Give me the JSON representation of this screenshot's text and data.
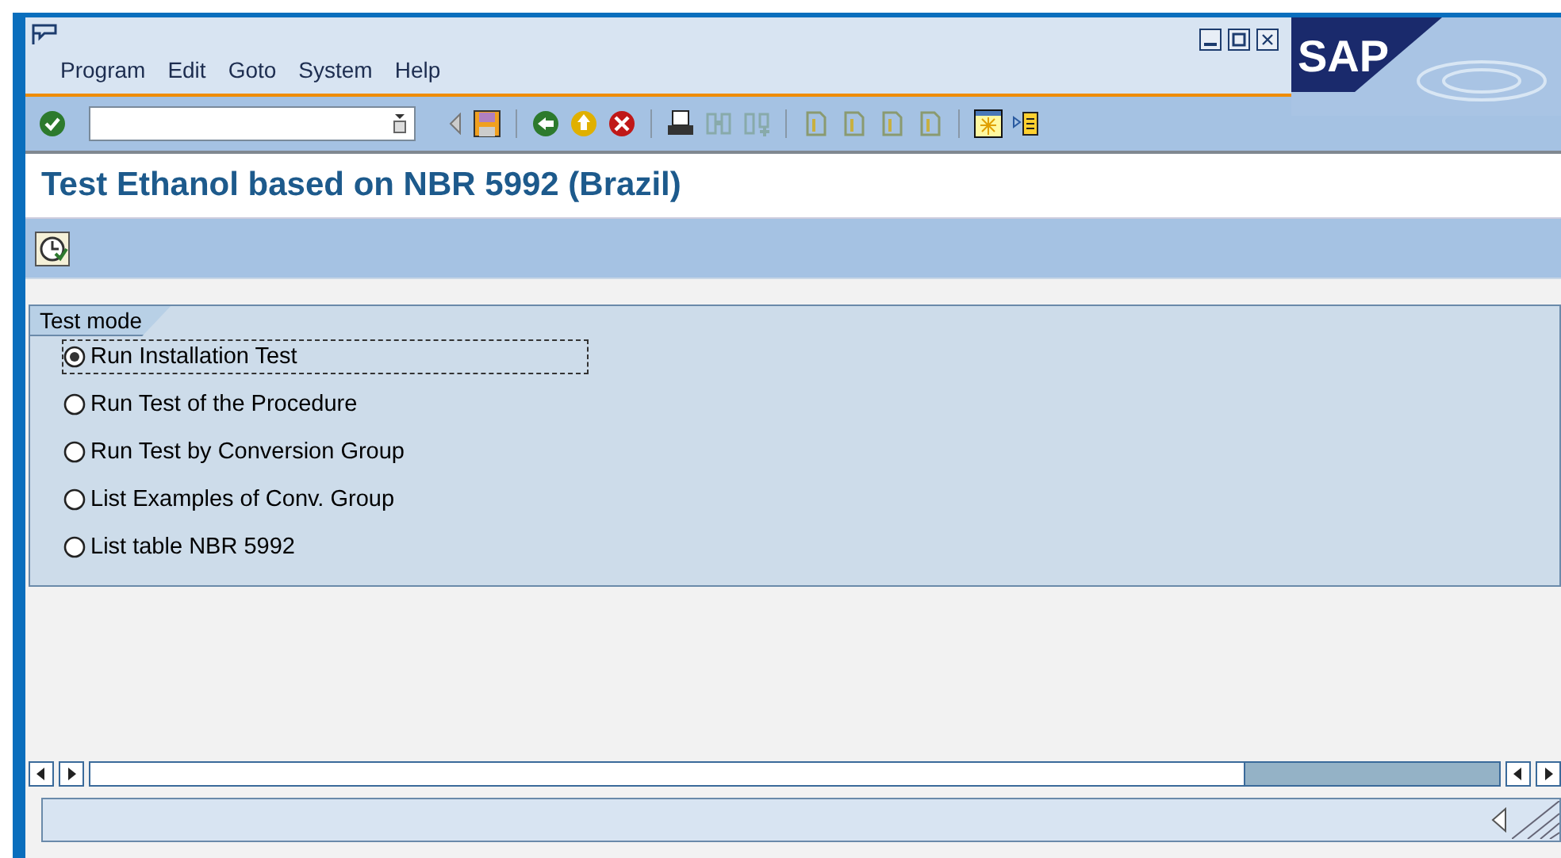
{
  "menu": [
    "Program",
    "Edit",
    "Goto",
    "System",
    "Help"
  ],
  "logo": "SAP",
  "title": "Test Ethanol based on NBR 5992 (Brazil)",
  "group": {
    "title": "Test mode",
    "options": [
      {
        "label": "Run Installation Test",
        "selected": true
      },
      {
        "label": "Run Test of the Procedure",
        "selected": false
      },
      {
        "label": "Run Test by Conversion Group",
        "selected": false
      },
      {
        "label": "List Examples of Conv. Group",
        "selected": false
      },
      {
        "label": "List table NBR 5992",
        "selected": false
      }
    ]
  }
}
